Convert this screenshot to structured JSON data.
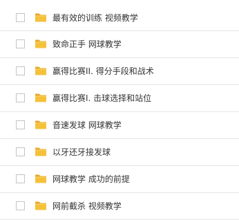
{
  "folders": [
    {
      "name": "最有效的训练  视频教学"
    },
    {
      "name": "致命正手  网球教学"
    },
    {
      "name": "赢得比赛II. 得分手段和战术"
    },
    {
      "name": "赢得比赛I. 击球选择和站位"
    },
    {
      "name": "音速发球  网球教学"
    },
    {
      "name": "以牙还牙接发球"
    },
    {
      "name": "网球教学  成功的前提"
    },
    {
      "name": "网前截杀  视频教学"
    }
  ],
  "colors": {
    "folder_body": "#f5c13b",
    "folder_tab": "#e8a92a",
    "row_divider": "#e6e6e6",
    "checkbox_border": "#c4c4c4",
    "text": "#333333"
  },
  "icon": "folder-icon"
}
